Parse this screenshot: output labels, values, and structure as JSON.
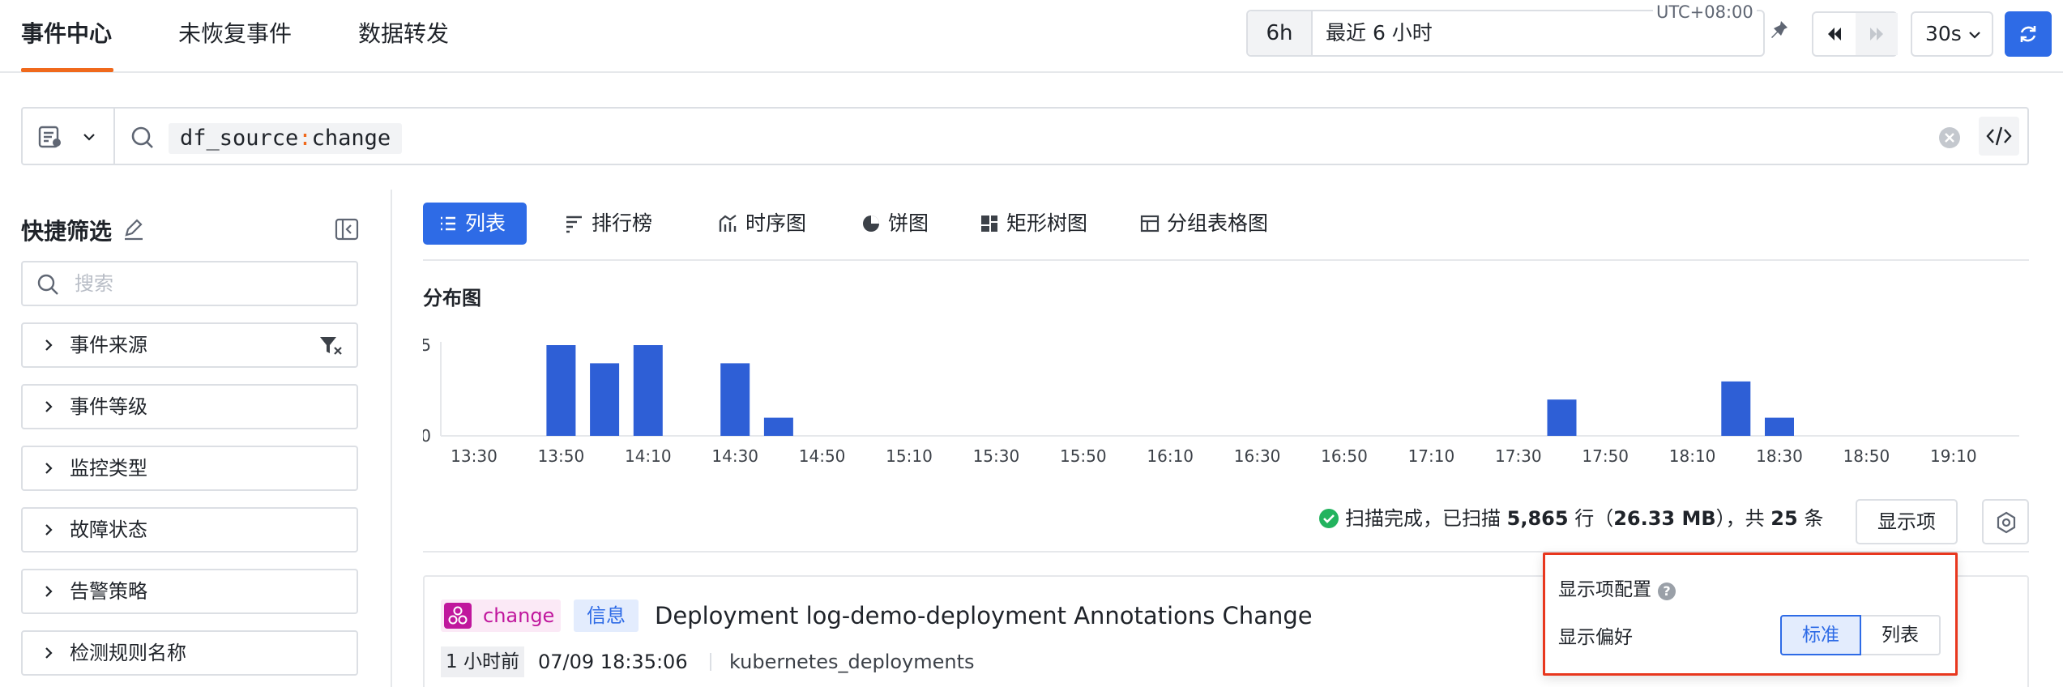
{
  "tabs": [
    {
      "label": "事件中心",
      "active": true
    },
    {
      "label": "未恢复事件",
      "active": false
    },
    {
      "label": "数据转发",
      "active": false
    }
  ],
  "time": {
    "range_button": "6h",
    "range_text": "最近 6 小时",
    "timezone": "UTC+08:00",
    "refresh_interval": "30s"
  },
  "search": {
    "query_key": "df_source",
    "query_sep": ":",
    "query_value": "change"
  },
  "sidebar": {
    "title": "快捷筛选",
    "search_placeholder": "搜索",
    "items": [
      {
        "label": "事件来源"
      },
      {
        "label": "事件等级"
      },
      {
        "label": "监控类型"
      },
      {
        "label": "故障状态"
      },
      {
        "label": "告警策略"
      },
      {
        "label": "检测规则名称"
      }
    ]
  },
  "view_tabs": [
    {
      "label": "列表",
      "icon": "list-icon",
      "active": true
    },
    {
      "label": "排行榜",
      "icon": "rank-icon",
      "active": false
    },
    {
      "label": "时序图",
      "icon": "timeseries-icon",
      "active": false
    },
    {
      "label": "饼图",
      "icon": "pie-icon",
      "active": false
    },
    {
      "label": "矩形树图",
      "icon": "treemap-icon",
      "active": false
    },
    {
      "label": "分组表格图",
      "icon": "group-table-icon",
      "active": false
    }
  ],
  "distribution": {
    "title": "分布图"
  },
  "chart_data": {
    "type": "bar",
    "ylim": [
      0,
      5
    ],
    "yticks": [
      "5",
      "0"
    ],
    "xticks": [
      "13:30",
      "13:50",
      "14:10",
      "14:30",
      "14:50",
      "15:10",
      "15:30",
      "15:50",
      "16:10",
      "16:30",
      "16:50",
      "17:10",
      "17:30",
      "17:50",
      "18:10",
      "18:30",
      "18:50",
      "19:10"
    ],
    "bars": [
      {
        "x": "13:50",
        "value": 5
      },
      {
        "x": "14:00",
        "value": 4
      },
      {
        "x": "14:10",
        "value": 5
      },
      {
        "x": "14:30",
        "value": 4
      },
      {
        "x": "14:40",
        "value": 1
      },
      {
        "x": "17:40",
        "value": 2
      },
      {
        "x": "18:20",
        "value": 3
      },
      {
        "x": "18:30",
        "value": 1
      }
    ],
    "color": "#2e5fd6"
  },
  "status": {
    "prefix": "扫描完成，已扫描 ",
    "rows": "5,865",
    "rows_unit": " 行（",
    "size": "26.33 MB",
    "size_close": "），共 ",
    "total": "25",
    "total_unit": " 条"
  },
  "buttons": {
    "display_items": "显示项"
  },
  "event": {
    "source_tag": "change",
    "level_tag": "信息",
    "title": "Deployment log-demo-deployment Annotations Change",
    "relative_time": "1 小时前",
    "absolute_time": "07/09 18:35:06",
    "source_name": "kubernetes_deployments"
  },
  "popup": {
    "title": "显示项配置",
    "pref_label": "显示偏好",
    "option_standard": "标准",
    "option_list": "列表"
  },
  "colors": {
    "accent": "#2e6be6",
    "tab_underline": "#f0691c",
    "source_tag": "#c0179d",
    "popup_border": "#e8371e",
    "success": "#22b35e"
  }
}
